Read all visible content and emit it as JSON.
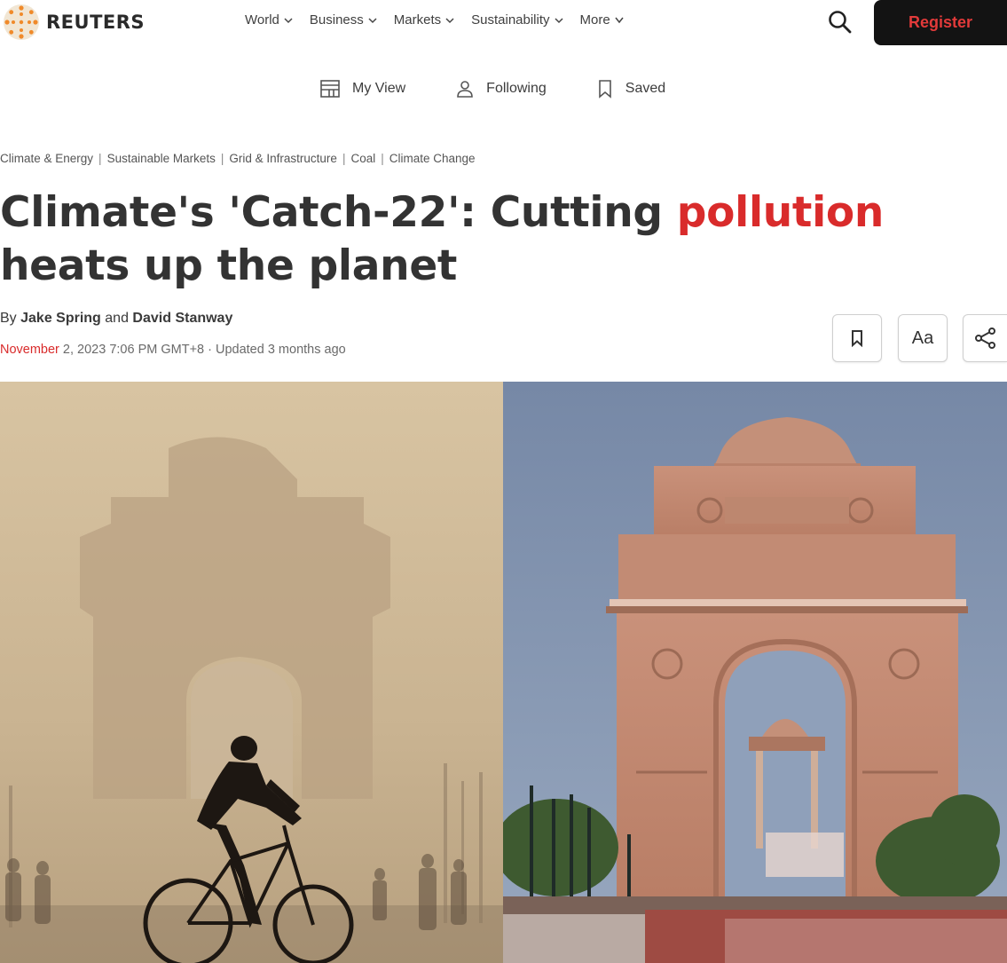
{
  "header": {
    "brand": "REUTERS",
    "nav": [
      {
        "label": "World"
      },
      {
        "label": "Business"
      },
      {
        "label": "Markets"
      },
      {
        "label": "Sustainability"
      },
      {
        "label": "More"
      }
    ],
    "register_label": "Register"
  },
  "subnav": [
    {
      "label": "My View",
      "icon": "layout-icon"
    },
    {
      "label": "Following",
      "icon": "person-icon"
    },
    {
      "label": "Saved",
      "icon": "bookmark-icon"
    }
  ],
  "topics": [
    "Climate & Energy",
    "Sustainable Markets",
    "Grid & Infrastructure",
    "Coal",
    "Climate Change"
  ],
  "article": {
    "headline_pre": "Climate's 'Catch-22': Cutting ",
    "headline_highlight": "pollution",
    "headline_post": " heats up the planet",
    "byline_prefix": "By ",
    "author1": "Jake Spring",
    "byline_and": " and ",
    "author2": "David Stanway",
    "date_month": "November",
    "date_rest": " 2, 2023 7:06 PM GMT+8 · Updated 3 months ago",
    "font_button_label": "Aa"
  },
  "colors": {
    "accent_red": "#d92b2b",
    "register_bg": "#131313",
    "smog": "#cdb896",
    "sky": "#8496b0",
    "sandstone": "#c48a70"
  }
}
